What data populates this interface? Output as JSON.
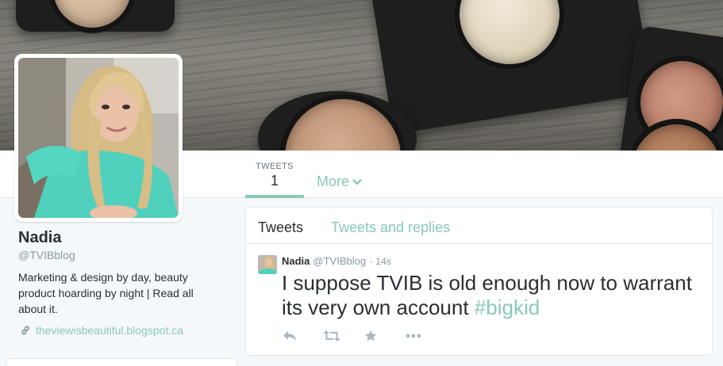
{
  "profile": {
    "name": "Nadia",
    "handle": "@TVIBblog",
    "bio": "Marketing & design by day, beauty product hoarding by night | Read all about it.",
    "website": "theviewisbeautiful.blogspot.ca"
  },
  "nav": {
    "tweets_label": "TWEETS",
    "tweets_count": "1",
    "more_label": "More"
  },
  "timeline": {
    "tabs": [
      "Tweets",
      "Tweets and replies"
    ]
  },
  "tweet": {
    "name": "Nadia",
    "handle": "@TVIBblog",
    "separator": "·",
    "time": "14s",
    "text": "I suppose TVIB is old enough now to warrant its very own account ",
    "hashtag": "#bigkid",
    "actions": [
      "reply-icon",
      "retweet-icon",
      "favorite-icon",
      "more-icon"
    ]
  },
  "colors": {
    "accent": "#89c9b8",
    "text": "#292f33",
    "muted": "#8899a6",
    "background": "#f5f8fa",
    "action_icon": "#aab8c2"
  }
}
